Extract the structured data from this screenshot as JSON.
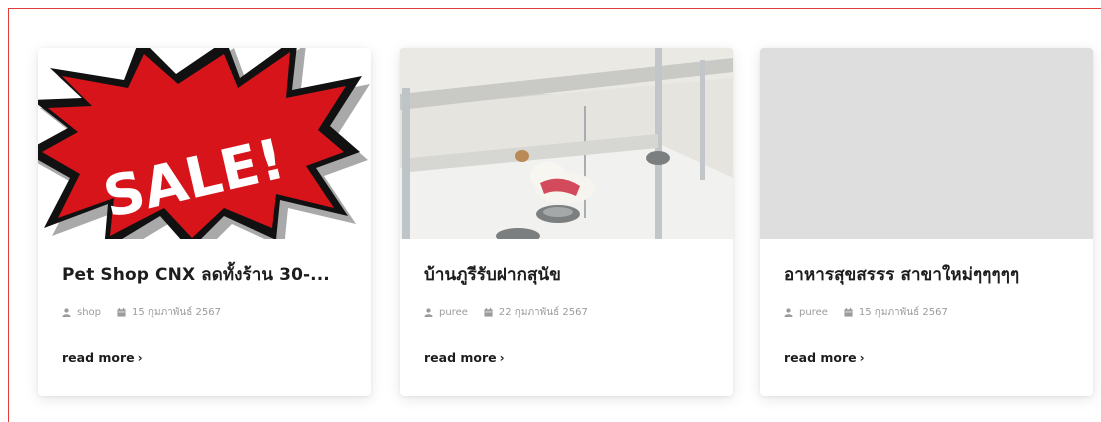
{
  "posts": [
    {
      "title": "Pet Shop CNX ลดทั้งร้าน 30-...",
      "author": "shop",
      "date": "15 กุมภาพันธ์ 2567",
      "read_more": "read more",
      "image_text": "SALE!"
    },
    {
      "title": "บ้านภูรีรับฝากสุนัข",
      "author": "puree",
      "date": "22 กุมภาพันธ์ 2567",
      "read_more": "read more"
    },
    {
      "title": "อาหารสุขสรรร สาขาใหม่ๆๆๆๆๆ",
      "author": "puree",
      "date": "15 กุมภาพันธ์ 2567",
      "read_more": "read more"
    }
  ],
  "icons": {
    "author": "user-icon",
    "date": "calendar-icon",
    "more": "chevron-right-icon"
  },
  "colors": {
    "frame_border": "#e23b3b",
    "title": "#1d1d1d",
    "meta": "#9b9b9b",
    "sale_red": "#d8141b"
  }
}
